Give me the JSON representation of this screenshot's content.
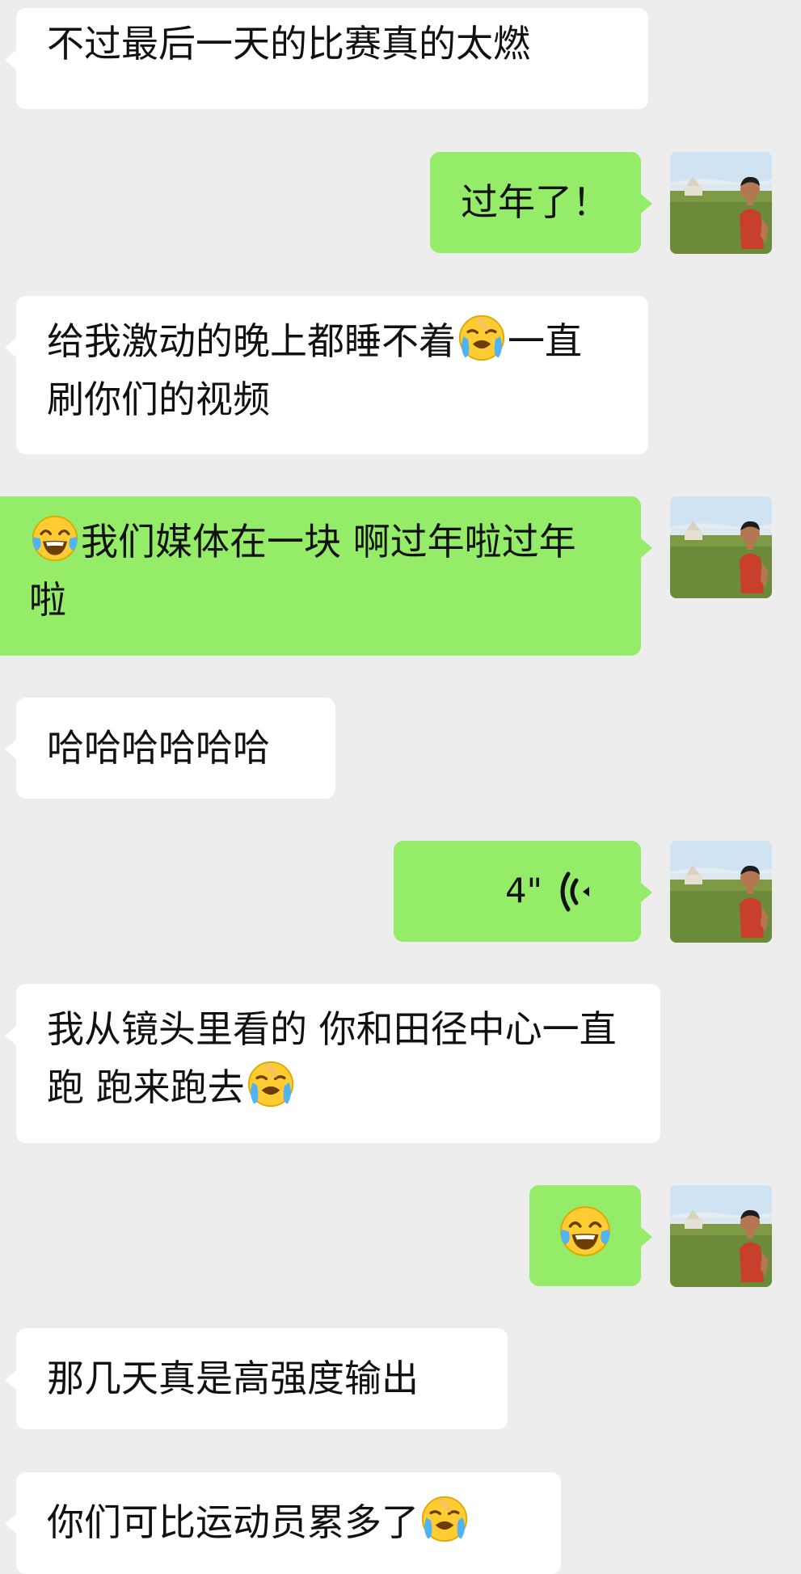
{
  "colors": {
    "background": "#ededed",
    "incoming_bubble": "#ffffff",
    "outgoing_bubble": "#95ec69",
    "text": "#111111"
  },
  "avatar": {
    "description_icon": "avatar-photo-icon"
  },
  "messages": [
    {
      "side": "in",
      "text": "不过最后一天的比赛真的太燃"
    },
    {
      "side": "out",
      "text": "过年了！"
    },
    {
      "side": "in",
      "text_before": "给我激动的晚上都睡不着",
      "emoji": "loudly-crying-face-icon",
      "text_after": "一直刷你们的视频"
    },
    {
      "side": "out",
      "emoji": "tears-of-joy-icon",
      "text_after": "我们媒体在一块 啊过年啦过年啦"
    },
    {
      "side": "in",
      "text": "哈哈哈哈哈哈"
    },
    {
      "side": "out",
      "type": "voice",
      "duration": "4\"",
      "icon": "voice-wave-icon"
    },
    {
      "side": "in",
      "text_before": "我从镜头里看的 你和田径中心一直跑 跑来跑去",
      "emoji": "loudly-crying-face-icon"
    },
    {
      "side": "out",
      "emoji": "tears-of-joy-icon"
    },
    {
      "side": "in",
      "text": "那几天真是高强度输出"
    },
    {
      "side": "in",
      "text_before": "你们可比运动员累多了",
      "emoji": "loudly-crying-face-icon"
    }
  ]
}
